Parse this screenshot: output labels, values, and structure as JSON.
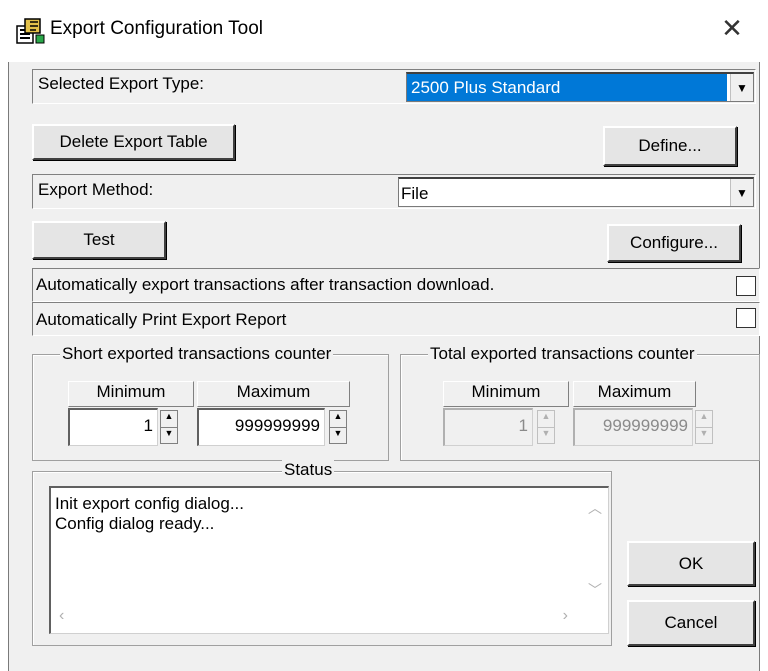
{
  "window": {
    "title": "Export Configuration Tool"
  },
  "export_type": {
    "label": "Selected Export Type:",
    "value": "2500 Plus Standard"
  },
  "buttons": {
    "delete": "Delete Export Table",
    "define": "Define...",
    "test": "Test",
    "configure": "Configure...",
    "ok": "OK",
    "cancel": "Cancel"
  },
  "export_method": {
    "label": "Export Method:",
    "value": "File"
  },
  "options": {
    "auto_export": {
      "label": "Automatically  export transactions after transaction download.",
      "checked": false
    },
    "auto_print": {
      "label": "Automatically Print Export Report",
      "checked": false
    }
  },
  "short_counter": {
    "title": "Short exported transactions counter",
    "min_label": "Minimum",
    "max_label": "Maximum",
    "min": "1",
    "max": "999999999"
  },
  "total_counter": {
    "title": "Total exported transactions counter",
    "min_label": "Minimum",
    "max_label": "Maximum",
    "min": "1",
    "max": "999999999",
    "disabled": true
  },
  "status": {
    "title": "Status",
    "lines": [
      "Init export config dialog...",
      "Config dialog ready..."
    ]
  },
  "icons": {
    "close": "close-icon",
    "dropdown": "chevron-down-icon",
    "app": "app-icon"
  }
}
